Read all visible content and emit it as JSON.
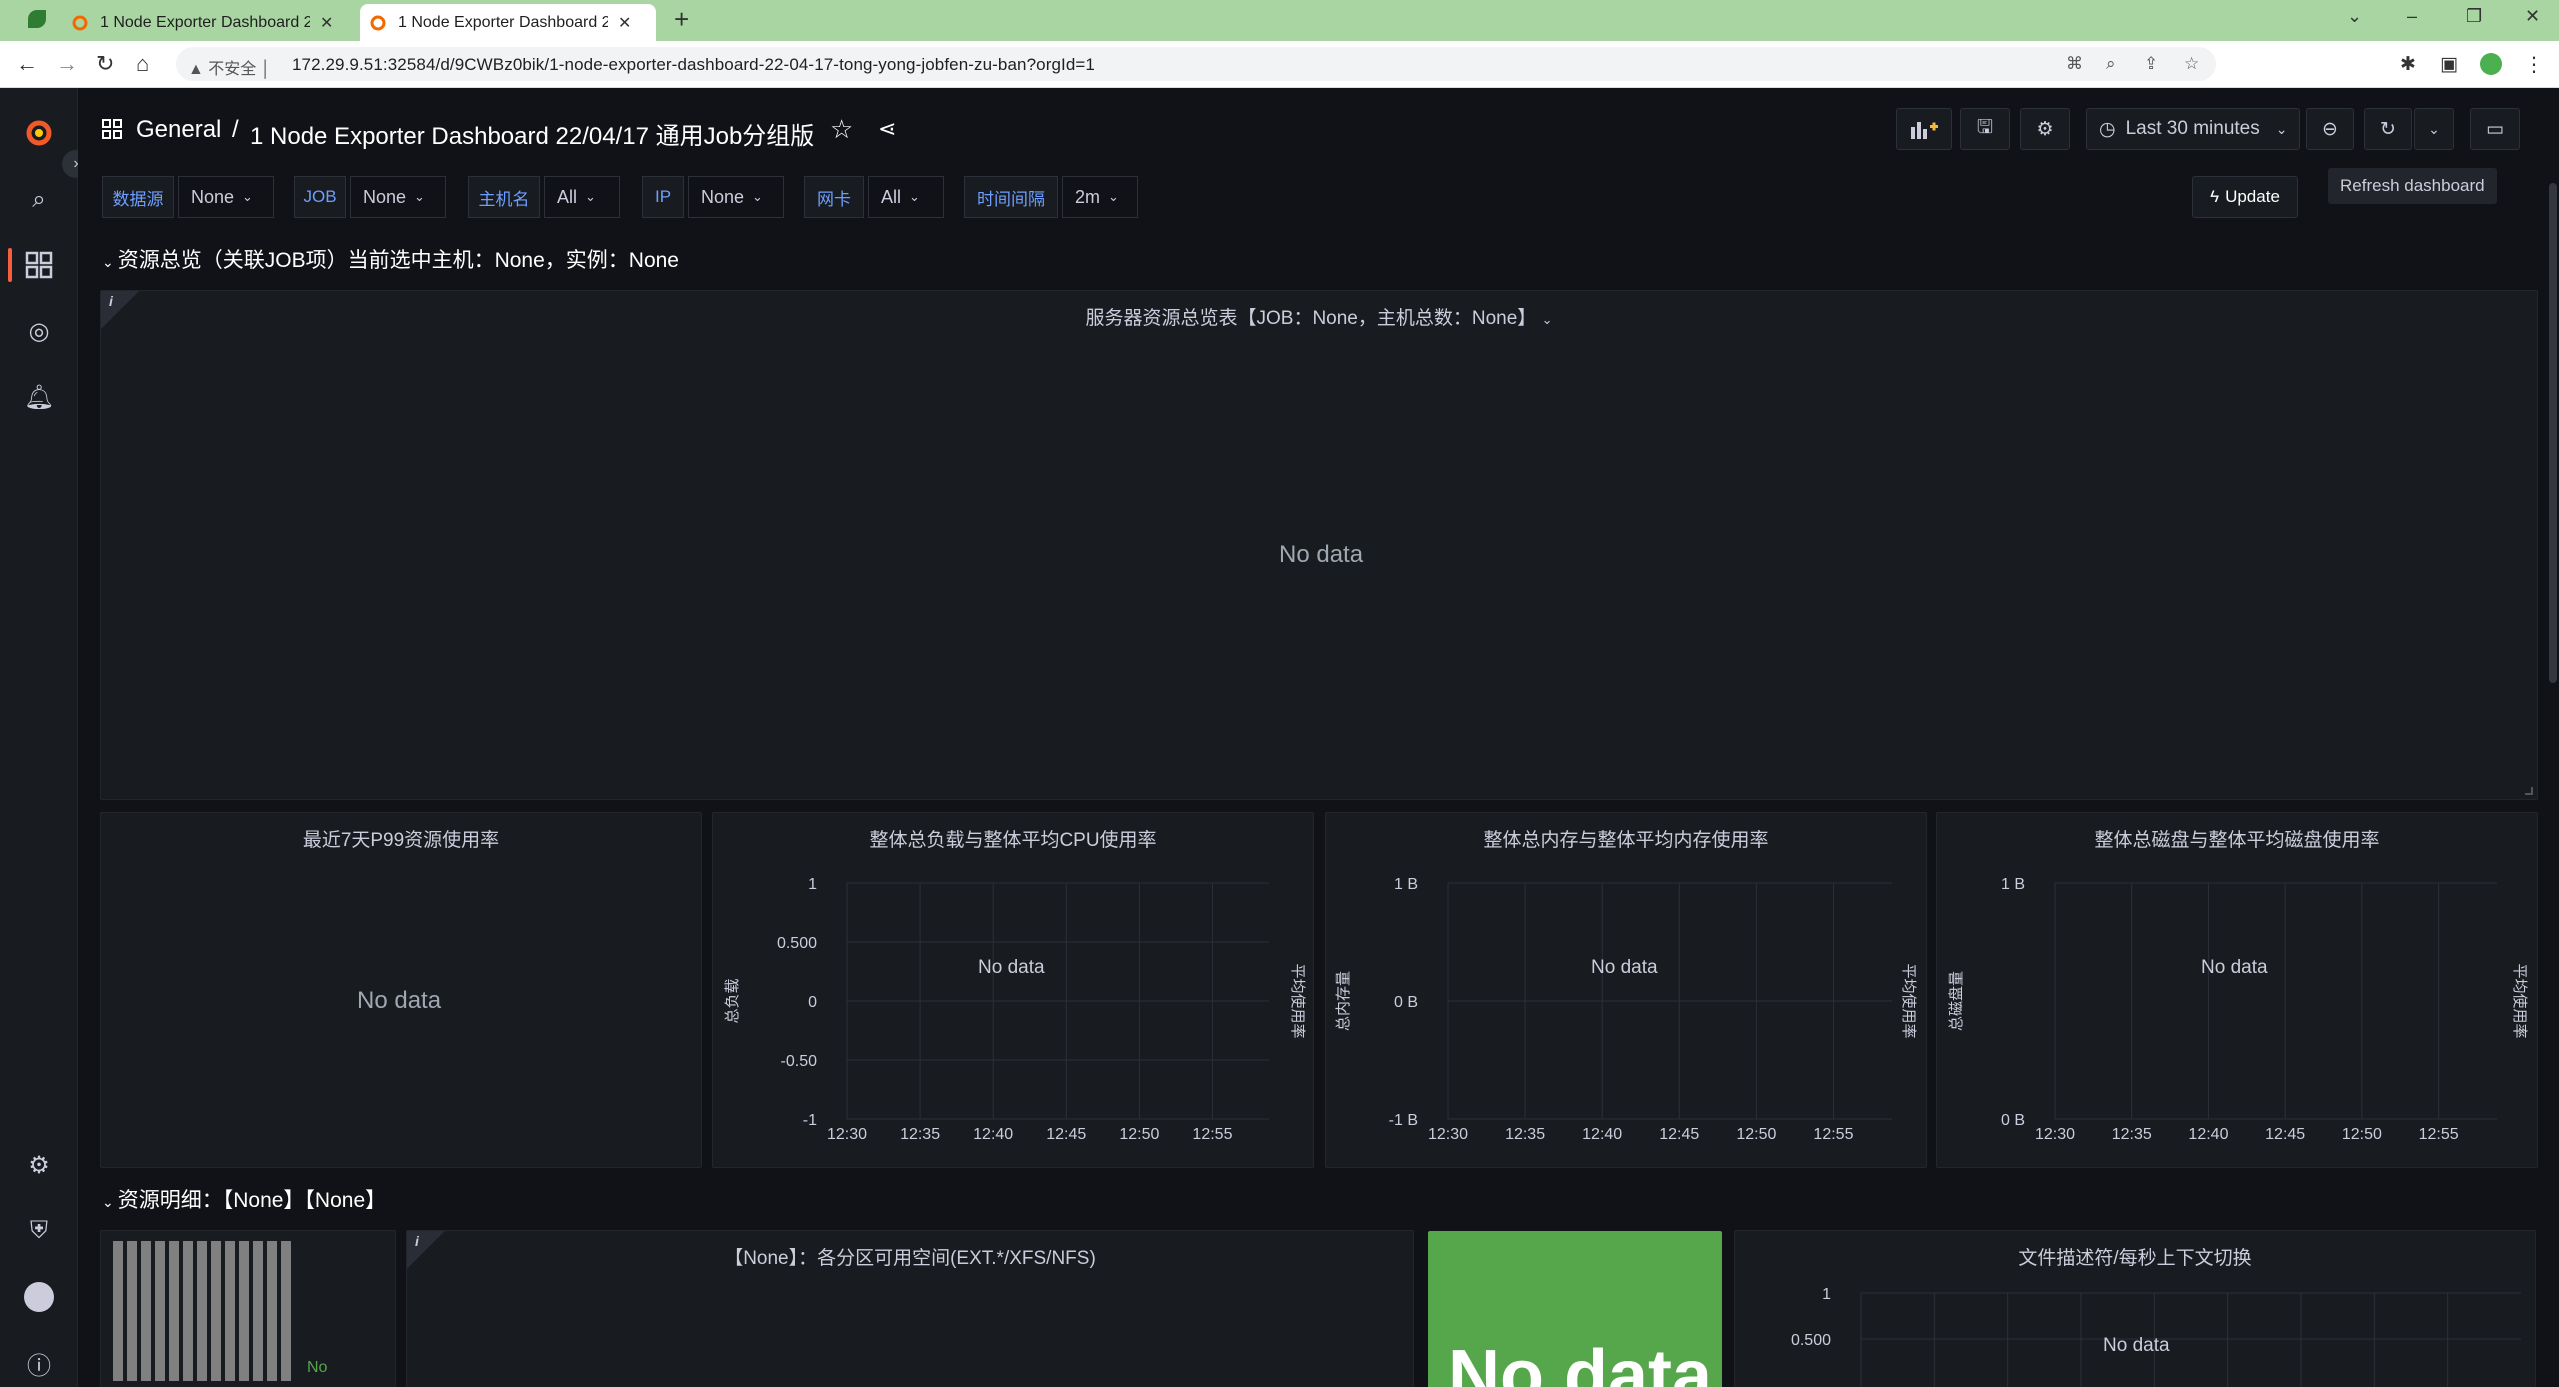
{
  "browser": {
    "tabs": [
      {
        "title": "1 Node Exporter Dashboard 2"
      },
      {
        "title": "1 Node Exporter Dashboard 2"
      }
    ],
    "insecure_label": "不安全",
    "url": "172.29.9.51:32584/d/9CWBz0bik/1-node-exporter-dashboard-22-04-17-tong-yong-jobfen-zu-ban?orgId=1"
  },
  "header": {
    "folder": "General",
    "separator": "/",
    "title": "1 Node Exporter Dashboard 22/04/17 通用Job分组版",
    "time_range": "Last 30 minutes",
    "tooltip": "Refresh dashboard",
    "update_label": "Update"
  },
  "variables": [
    {
      "label": "数据源",
      "value": "None"
    },
    {
      "label": "JOB",
      "value": "None"
    },
    {
      "label": "主机名",
      "value": "All"
    },
    {
      "label": "IP",
      "value": "None"
    },
    {
      "label": "网卡",
      "value": "All"
    },
    {
      "label": "时间间隔",
      "value": "2m"
    }
  ],
  "rows": [
    {
      "title": "资源总览（关联JOB项）当前选中主机：None，实例：None"
    },
    {
      "title": "资源明细：【None】【None】"
    }
  ],
  "panels": {
    "overview": {
      "title": "服务器资源总览表【JOB：None，主机总数：None】",
      "nodata": "No data"
    },
    "p99": {
      "title": "最近7天P99资源使用率",
      "nodata": "No data"
    },
    "cpu": {
      "title": "整体总负载与整体平均CPU使用率",
      "nodata": "No data",
      "ylabel": "总负载",
      "y2label": "平均使用率"
    },
    "mem": {
      "title": "整体总内存与整体平均内存使用率",
      "nodata": "No data",
      "ylabel": "总内存量",
      "y2label": "平均使用率"
    },
    "disk": {
      "title": "整体总磁盘与整体平均磁盘使用率",
      "nodata": "No data",
      "ylabel": "总磁盘量",
      "y2label": "平均使用率"
    },
    "partition": {
      "title": "【None】：各分区可用空间(EXT.*/XFS/NFS)"
    },
    "big_stat": {
      "nodata": "No data"
    },
    "small_bar": {
      "nodata": "No"
    },
    "fd": {
      "title": "文件描述符/每秒上下文切换",
      "nodata": "No data"
    }
  },
  "chart_data": [
    {
      "type": "line",
      "title": "整体总负载与整体平均CPU使用率",
      "ylabel": "总负载",
      "y2label": "平均使用率",
      "x_ticks": [
        "12:30",
        "12:35",
        "12:40",
        "12:45",
        "12:50",
        "12:55"
      ],
      "y_ticks": [
        "1",
        "0.500",
        "0",
        "-0.50",
        "-1"
      ],
      "ylim": [
        -1,
        1
      ],
      "series": []
    },
    {
      "type": "line",
      "title": "整体总内存与整体平均内存使用率",
      "ylabel": "总内存量",
      "y2label": "平均使用率",
      "x_ticks": [
        "12:30",
        "12:35",
        "12:40",
        "12:45",
        "12:50",
        "12:55"
      ],
      "y_ticks": [
        "1 B",
        "0 B",
        "-1 B"
      ],
      "ylim": [
        -1,
        1
      ],
      "series": []
    },
    {
      "type": "line",
      "title": "整体总磁盘与整体平均磁盘使用率",
      "ylabel": "总磁盘量",
      "y2label": "平均使用率",
      "x_ticks": [
        "12:30",
        "12:35",
        "12:40",
        "12:45",
        "12:50",
        "12:55"
      ],
      "y_ticks": [
        "1 B",
        "0 B"
      ],
      "ylim": [
        0,
        1
      ],
      "series": []
    },
    {
      "type": "line",
      "title": "文件描述符/每秒上下文切换",
      "y_ticks": [
        "1",
        "0.500"
      ],
      "series": []
    }
  ],
  "colors": {
    "accent": "#6e9fff",
    "stat_green": "#56a64b",
    "bg": "#111217",
    "panel": "#181b1f"
  }
}
